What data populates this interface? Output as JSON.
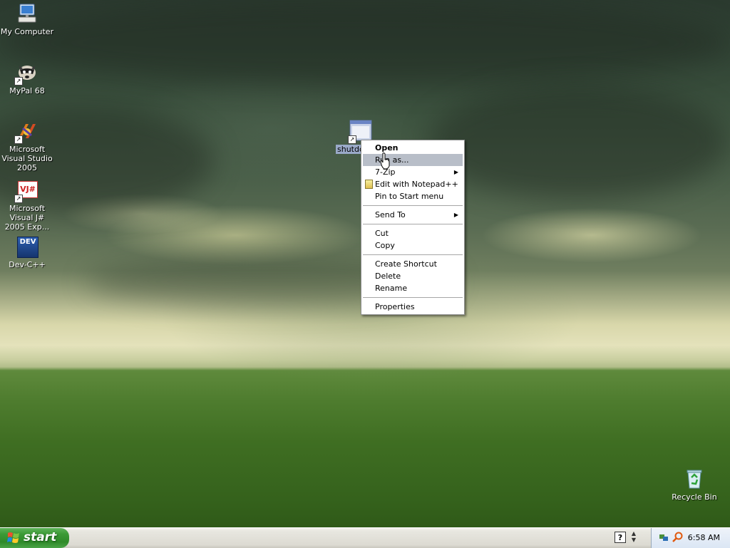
{
  "desktop": {
    "icons": [
      {
        "label": "My Computer"
      },
      {
        "label": "MyPal 68"
      },
      {
        "label": "Microsoft Visual Studio 2005"
      },
      {
        "label": "Microsoft Visual J# 2005 Exp..."
      },
      {
        "label": "Dev-C++"
      },
      {
        "label": "Recycle Bin"
      }
    ],
    "selected_icon": {
      "label": "shutdo"
    },
    "vj_badge": "VJ#",
    "dev_badge": "DEV"
  },
  "context_menu": {
    "items": [
      {
        "label": "Open",
        "bold": true
      },
      {
        "label": "Run as...",
        "hovered": true
      },
      {
        "label": "7-Zip",
        "submenu": true
      },
      {
        "label": "Edit with Notepad++"
      },
      {
        "label": "Pin to Start menu"
      },
      {
        "label": "Send To",
        "submenu": true
      },
      {
        "label": "Cut"
      },
      {
        "label": "Copy"
      },
      {
        "label": "Create Shortcut"
      },
      {
        "label": "Delete"
      },
      {
        "label": "Rename"
      },
      {
        "label": "Properties"
      }
    ],
    "submenu_glyph": "▶"
  },
  "taskbar": {
    "start_label": "start",
    "help_icon_glyph": "?",
    "clock": "6:58 AM"
  },
  "colors": {
    "menu_hover": "#b8bec8",
    "start_green": "#3c9a36",
    "selection_blue": "#316ac5"
  }
}
